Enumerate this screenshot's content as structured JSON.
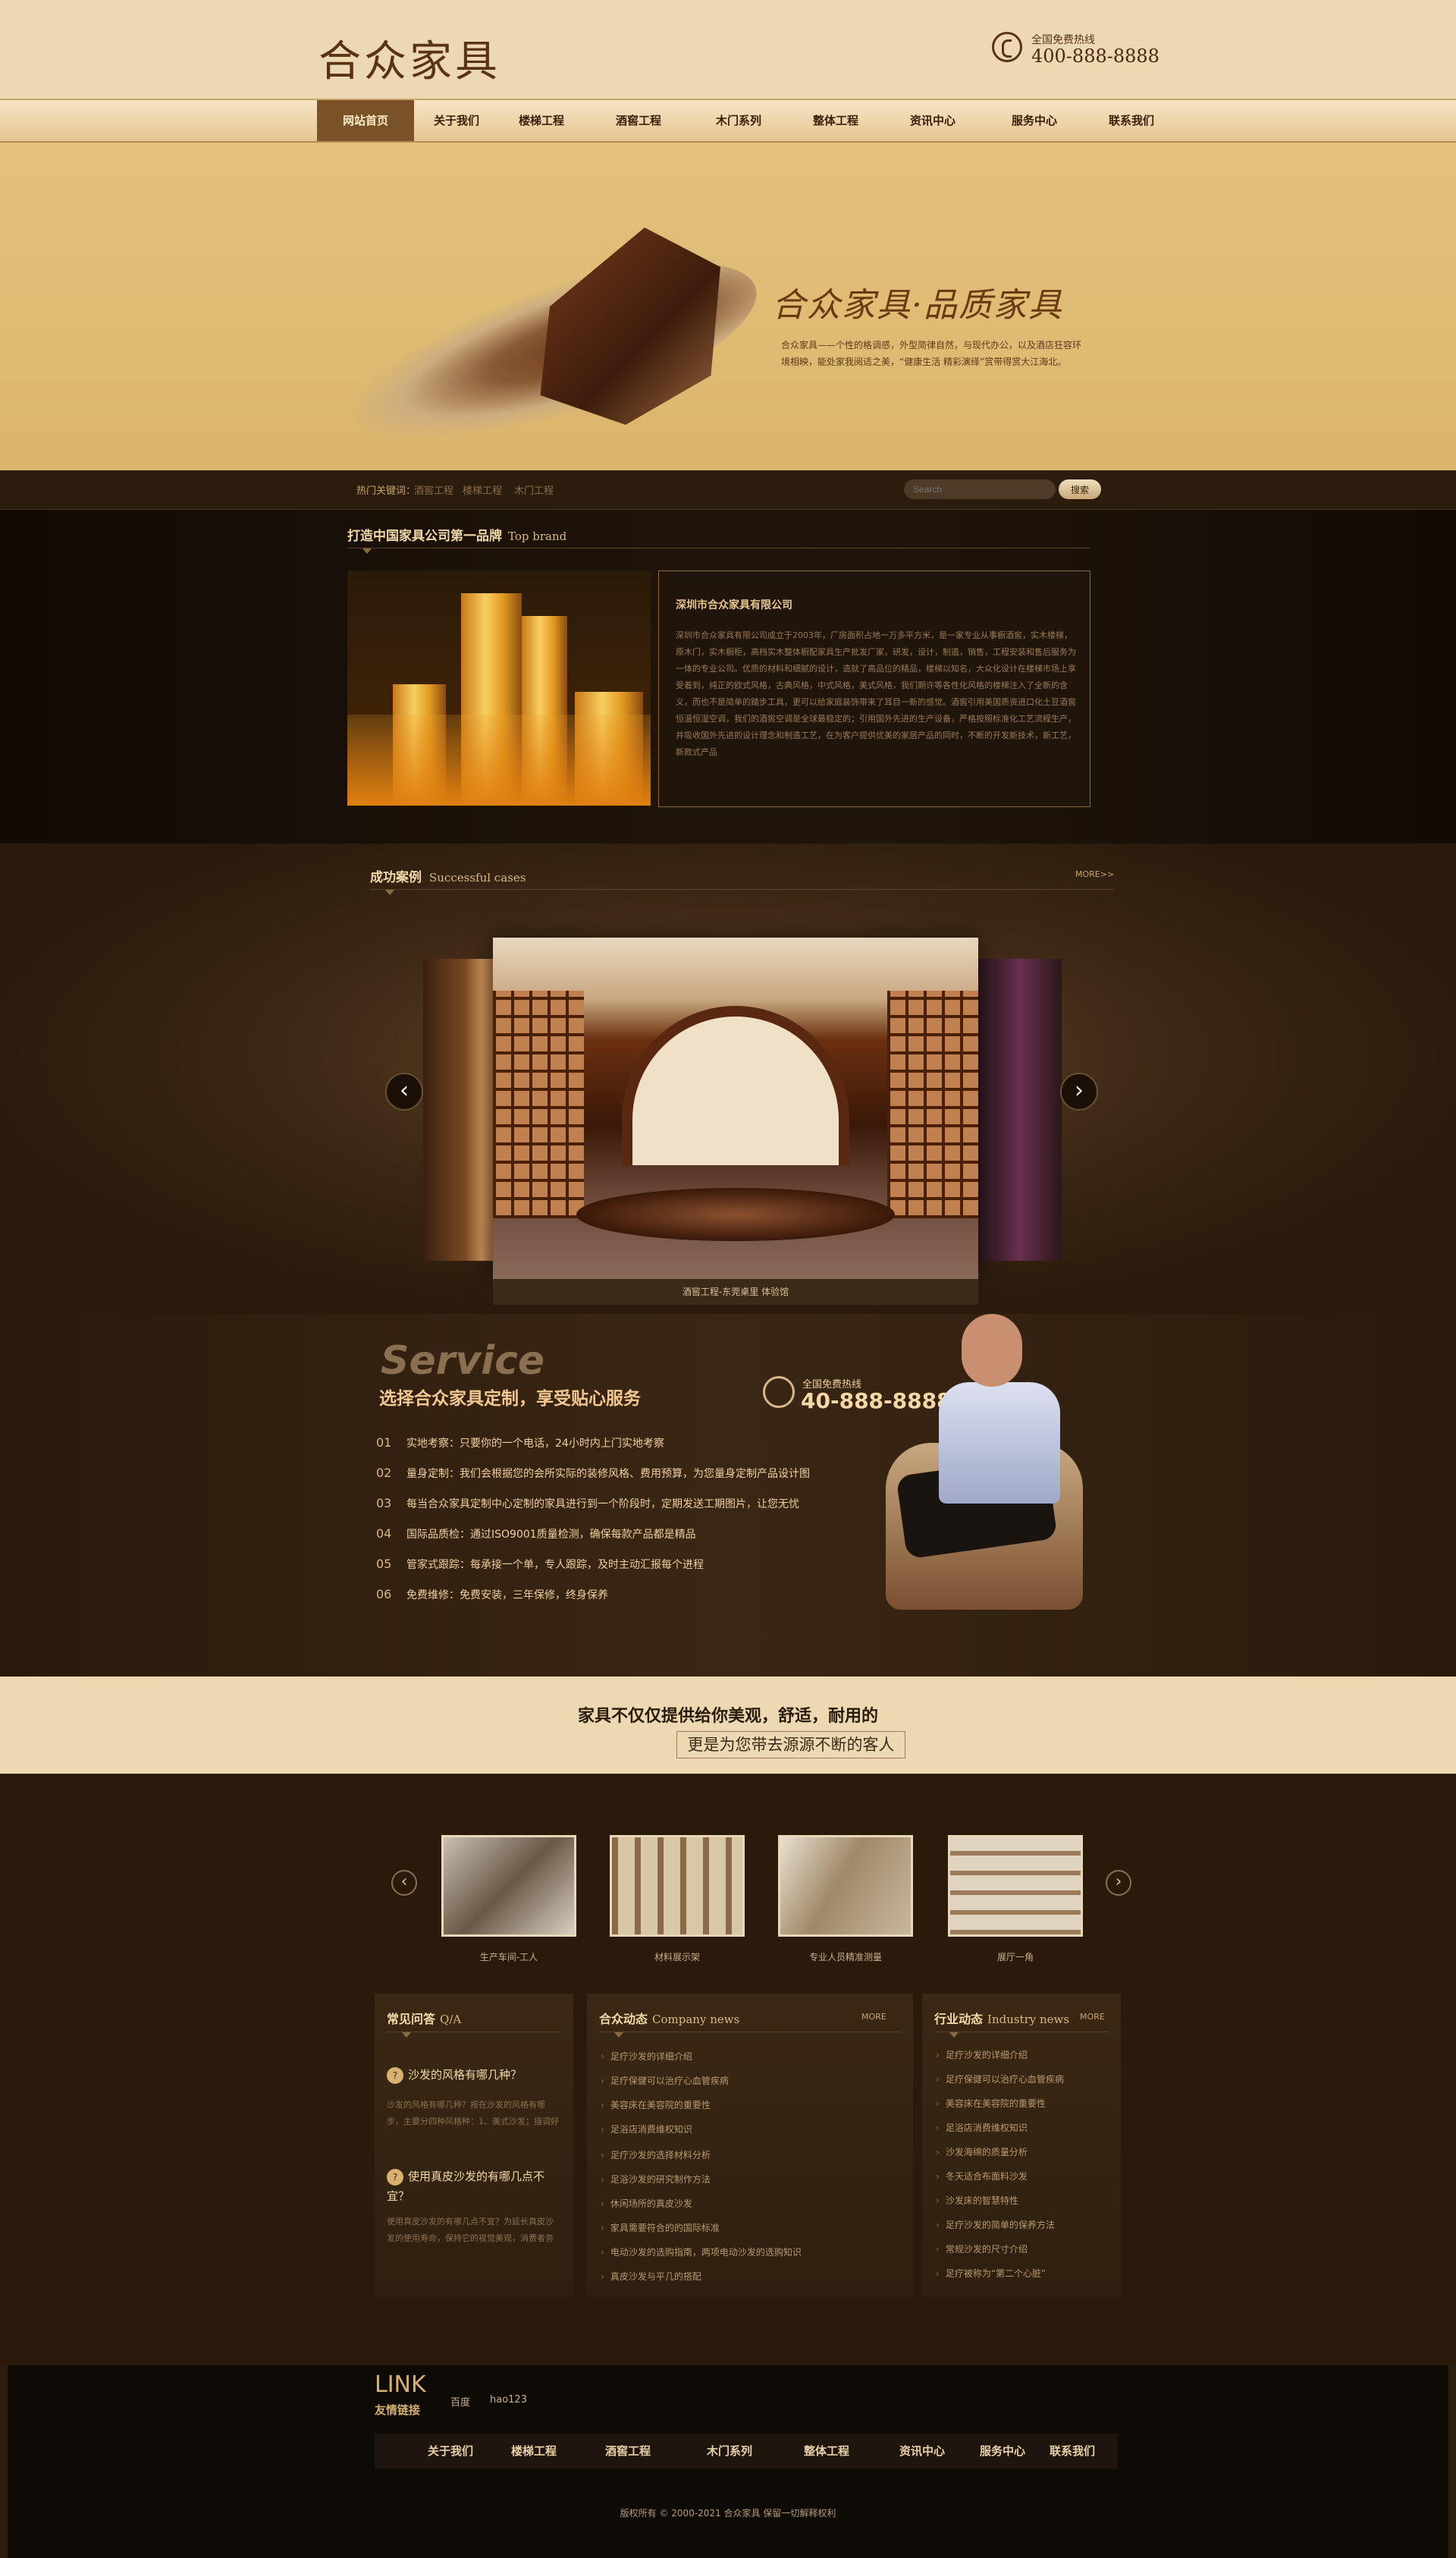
{
  "header": {
    "logo": "合众家具",
    "hotline_label": "全国免费热线",
    "hotline_number": "400-888-8888"
  },
  "nav": [
    {
      "label": "网站首页",
      "active": true
    },
    {
      "label": "关于我们"
    },
    {
      "label": "楼梯工程"
    },
    {
      "label": "酒窖工程"
    },
    {
      "label": "木门系列"
    },
    {
      "label": "整体工程"
    },
    {
      "label": "资讯中心"
    },
    {
      "label": "服务中心"
    },
    {
      "label": "联系我们"
    }
  ],
  "banner": {
    "slogan": "合众家具·品质家具",
    "desc": "合众家具——个性的格调感，外型简律自然，与现代办公，以及酒店狂容环境相映，能处家我阅适之美，“健康生活 精彩演绎”赏带得赏大江海北。"
  },
  "keywords": {
    "label": "热门关键词：",
    "items": [
      "酒窖工程",
      "楼梯工程",
      "木门工程"
    ]
  },
  "search": {
    "placeholder": "Search",
    "button": "搜索"
  },
  "intro": {
    "title": "打造中国家具公司第一品牌",
    "title_en": "Top brand",
    "company": "深圳市合众家具有限公司",
    "text": "深圳市合众家具有限公司成立于2003年，厂房面积占地一万多平方米，是一家专业从事橱酒窖，实木楼梯，原木门，实木橱柜，高档实木整体橱配家具生产批发厂家，研发，设计，制造，销售，工程安装和售后服务为一体的专业公司。优质的材料和细腻的设计，造就了高品位的精品，楼梯以知名，大众化设计在楼梯市场上享受着到，纯正的欧式风格，古典风格，中式风格，美式风格，我们期许等各性化风格的楼梯注入了全新的含义，而也不是简单的踏步工具，更可以给家庭装饰带来了耳目一新的感觉。酒窖引用美国质资进口化土豆酒窖恒温恒湿空调，我们的酒窖空调是全球最稳定的；引用国外先进的生产设备，严格按照标准化工艺流程生产，并吸收国外先进的设计理念和制造工艺，在为客户提供优美的家居产品的同时，不断的开发新技术，新工艺，新款式产品"
  },
  "cases": {
    "title": "成功案例",
    "title_en": "Successful cases",
    "more": "MORE>>",
    "caption": "酒窖工程-东莞桌里 体验馆",
    "prev": "‹",
    "next": "›"
  },
  "service": {
    "big": "Service",
    "sub": "选择合众家具定制，享受贴心服务",
    "hot_label": "全国免费热线",
    "hot_number": "40-888-8888",
    "items": [
      {
        "no": "01",
        "text": "实地考察：只要你的一个电话，24小时内上门实地考察"
      },
      {
        "no": "02",
        "text": "量身定制：我们会根据您的会所实际的装修风格、费用预算，为您量身定制产品设计图"
      },
      {
        "no": "03",
        "text": "每当合众家具定制中心定制的家具进行到一个阶段时，定期发送工期图片，让您无忧"
      },
      {
        "no": "04",
        "text": "国际品质检：通过ISO9001质量检测，确保每款产品都是精品"
      },
      {
        "no": "05",
        "text": "管家式跟踪：每承接一个单，专人跟踪，及时主动汇报每个进程"
      },
      {
        "no": "06",
        "text": "免费维修：免费安装，三年保修，终身保养"
      }
    ]
  },
  "tagline": {
    "line1": "家具不仅仅提供给你美观，舒适，耐用的",
    "line2": "更是为您带去源源不断的客人"
  },
  "gallery": {
    "prev": "‹",
    "next": "›",
    "items": [
      {
        "caption": "生产车间-工人"
      },
      {
        "caption": "材料展示架"
      },
      {
        "caption": "专业人员精准测量"
      },
      {
        "caption": "展厅一角"
      }
    ]
  },
  "qa": {
    "title": "常见问答",
    "title_en": "Q/A",
    "items": [
      {
        "q": "沙发的风格有哪几种？",
        "a": "沙发的风格有哪几种？按在沙发的风格有哪步，主要分四种风格种：1、美式沙发；描调好"
      },
      {
        "q": "使用真皮沙发的有哪几点不宜？",
        "a": "使用真皮沙发的有哪几点不宜？为延长真皮沙发的使用寿命，保持它的视觉美观，消费者务"
      }
    ]
  },
  "company_news": {
    "title": "合众动态",
    "title_en": "Company news",
    "more": "MORE",
    "items": [
      "足疗沙发的详细介绍",
      "足疗保健可以治疗心血管疾病",
      "美容床在美容院的重要性",
      "足浴店消费维权知识",
      "足疗沙发的选择材料分析",
      "足浴沙发的研究制作方法",
      "休闲场所的真皮沙发",
      "家具需要符合的的国际标准",
      "电动沙发的选购指南，两项电动沙发的选购知识",
      "真皮沙发与平几的搭配"
    ]
  },
  "industry_news": {
    "title": "行业动态",
    "title_en": "Industry news",
    "more": "MORE",
    "items": [
      "足疗沙发的详细介绍",
      "足疗保健可以治疗心血管疾病",
      "美容床在美容院的重要性",
      "足浴店消费维权知识",
      "沙发海绵的质量分析",
      "冬天适合布面料沙发",
      "沙发床的智慧特性",
      "足疗沙发的简单的保养方法",
      "常规沙发的尺寸介绍",
      "足疗被称为“第二个心脏”"
    ]
  },
  "links": {
    "title_en": "LINK",
    "title_cn": "友情链接",
    "items": [
      "百度",
      "hao123"
    ]
  },
  "footer_nav": [
    "关于我们",
    "楼梯工程",
    "酒窖工程",
    "木门系列",
    "整体工程",
    "资讯中心",
    "服务中心",
    "联系我们"
  ],
  "copyright": "版权所有 © 2000-2021 合众家具 保留一切解释权利"
}
